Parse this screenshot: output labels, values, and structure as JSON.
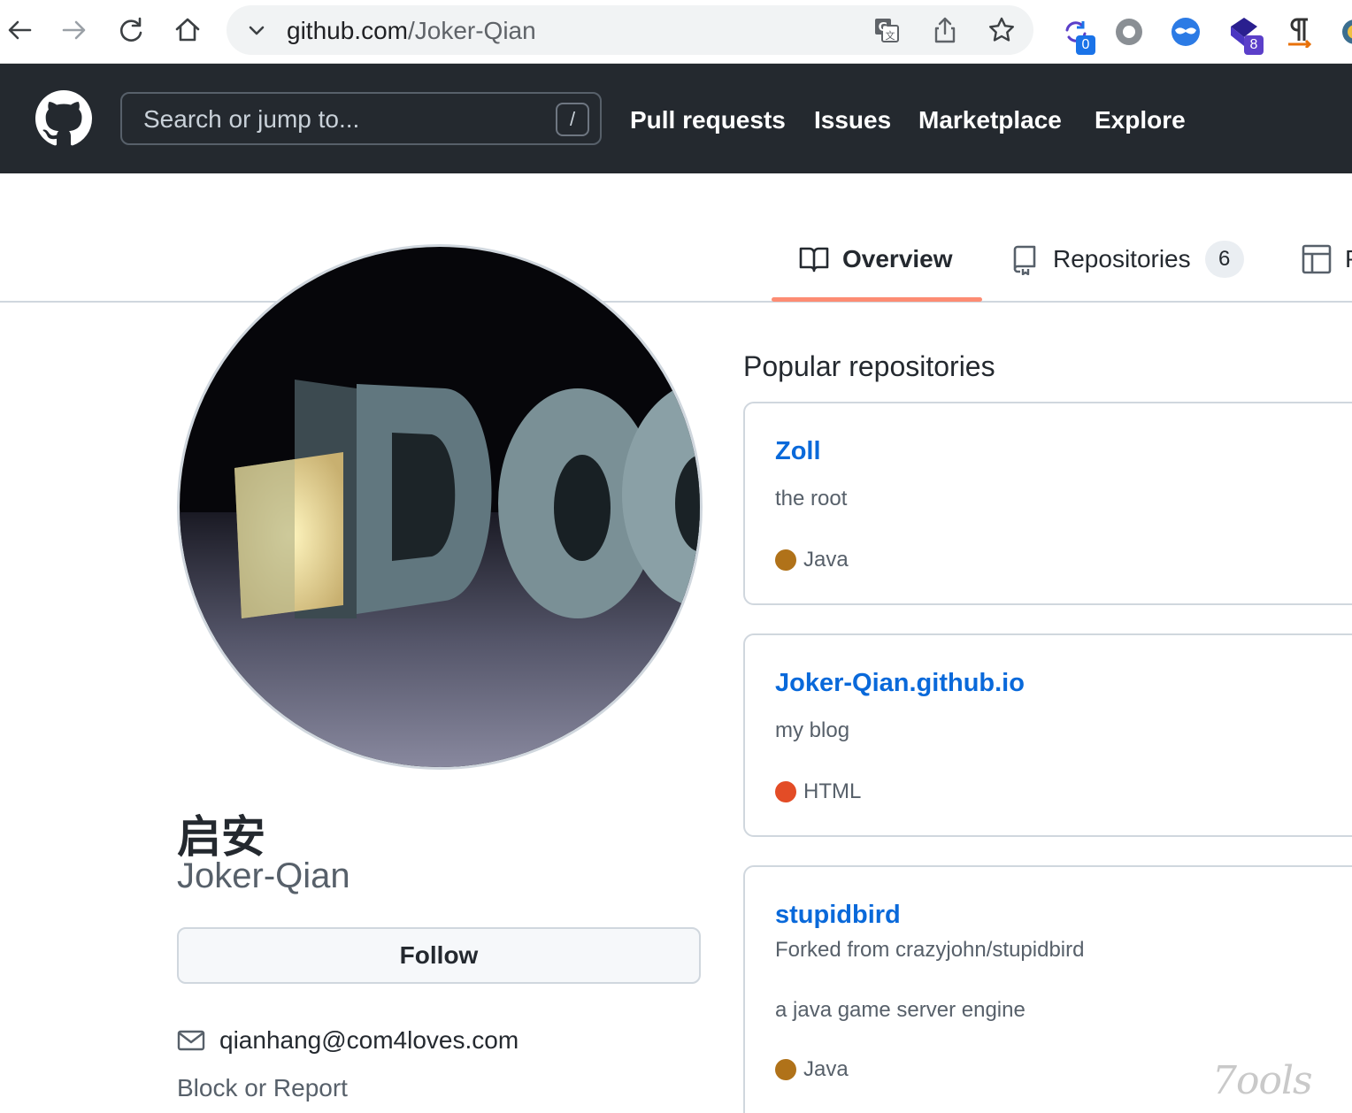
{
  "browser": {
    "url_host": "github.com",
    "url_path": "/Joker-Qian",
    "extensions": [
      {
        "name": "sync-extension-icon",
        "badge": "0",
        "badge_color": "#1a73e8"
      },
      {
        "name": "circle-extension-icon",
        "badge": ""
      },
      {
        "name": "mask-extension-icon",
        "badge": ""
      },
      {
        "name": "cube-extension-icon",
        "badge": "8",
        "badge_color": "#5b3fc9"
      },
      {
        "name": "paragraph-extension-icon",
        "badge": ""
      }
    ]
  },
  "header": {
    "search_placeholder": "Search or jump to...",
    "search_shortcut": "/",
    "nav": [
      "Pull requests",
      "Issues",
      "Marketplace",
      "Explore"
    ]
  },
  "tabs": {
    "overview": "Overview",
    "repositories": "Repositories",
    "repositories_count": "6",
    "projects": "P"
  },
  "profile": {
    "display_name": "启安",
    "username": "Joker-Qian",
    "follow_label": "Follow",
    "email": "qianhang@com4loves.com",
    "block_label": "Block or Report"
  },
  "popular": {
    "title": "Popular repositories",
    "repos": [
      {
        "name": "Zoll",
        "forked_from": "",
        "description": "the root",
        "language": "Java",
        "lang_color": "#b07219"
      },
      {
        "name": "Joker-Qian.github.io",
        "forked_from": "",
        "description": "my blog",
        "language": "HTML",
        "lang_color": "#e34c26"
      },
      {
        "name": "stupidbird",
        "forked_from": "Forked from crazyjohn/stupidbird",
        "description": "a java game server engine",
        "language": "Java",
        "lang_color": "#b07219"
      }
    ]
  },
  "watermark": "7ools",
  "colors": {
    "accent_link": "#0969da",
    "header_bg": "#24292f",
    "tab_underline": "#fd8c73"
  }
}
